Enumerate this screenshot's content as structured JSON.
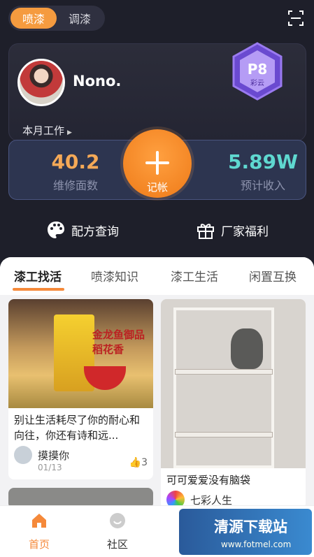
{
  "top_switch": {
    "items": [
      "喷漆",
      "调漆"
    ],
    "active": 0
  },
  "profile": {
    "username": "Nono.",
    "badge_level": "P8",
    "badge_name": "彩云"
  },
  "month_work_label": "本月工作",
  "stats": {
    "left_value": "40.2",
    "left_label": "维修面数",
    "right_value": "5.89W",
    "right_label": "预计收入",
    "add_label": "记帐"
  },
  "quick_links": [
    {
      "label": "配方查询",
      "icon": "palette-icon"
    },
    {
      "label": "厂家福利",
      "icon": "gift-icon"
    }
  ],
  "tabs": [
    "漆工找活",
    "喷漆知识",
    "漆工生活",
    "闲置互换"
  ],
  "feed": [
    {
      "title": "别让生活耗尽了你的耐心和向往，你还有诗和远...",
      "author": "摸摸你",
      "date": "01/13",
      "likes": "3",
      "image_text": "金龙鱼御品稻花香",
      "image_icon": "rice-ad-image"
    },
    {
      "title": "可可爱爱没有脑袋",
      "author": "七彩人生",
      "image_icon": "cat-on-shelf-image"
    }
  ],
  "bottom_nav": [
    {
      "label": "首页",
      "icon": "home-icon",
      "active": true
    },
    {
      "label": "社区",
      "icon": "community-icon",
      "active": false
    }
  ],
  "watermark": {
    "text": "清源下载站",
    "url": "www.fotmel.com"
  },
  "colors": {
    "accent": "#f5893a",
    "bg": "#1e1f2a",
    "teal": "#5fd8d0"
  }
}
